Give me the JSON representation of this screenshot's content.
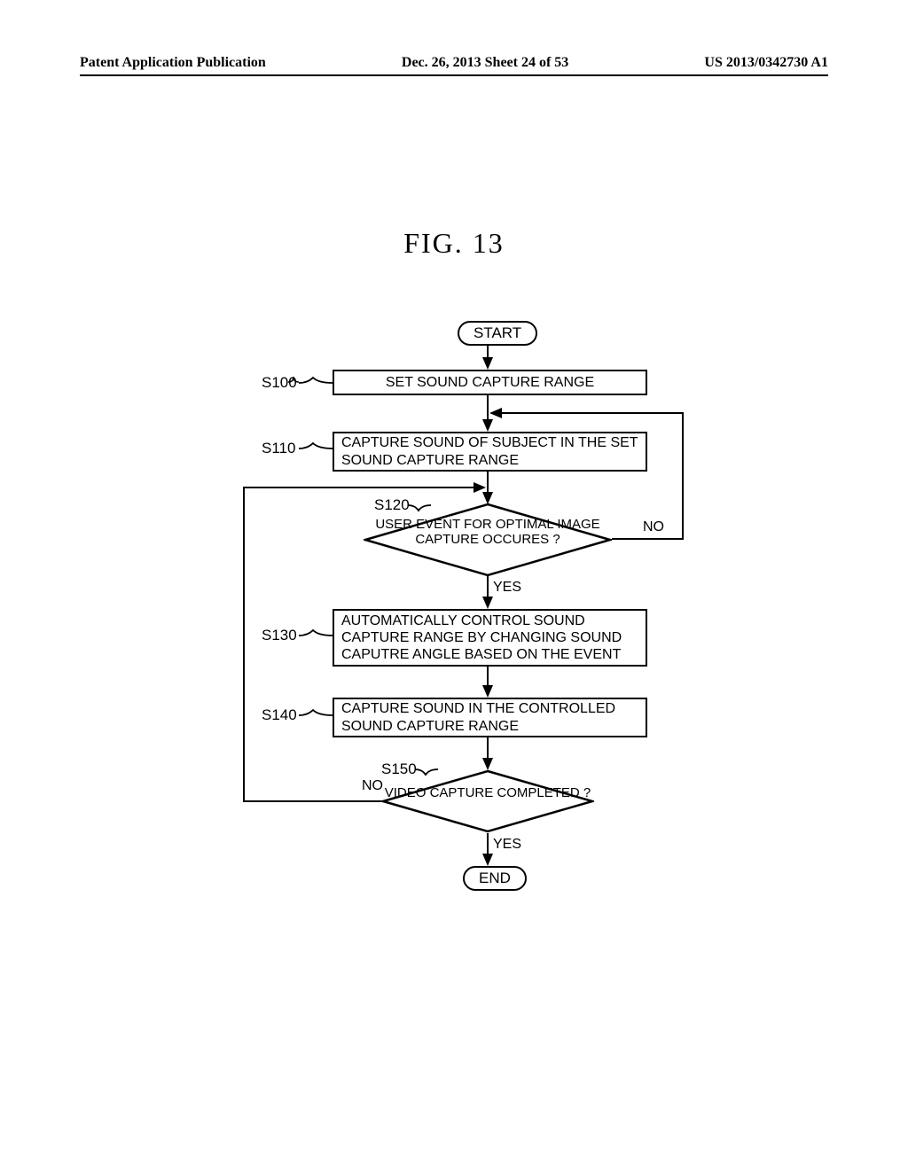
{
  "header": {
    "left": "Patent Application Publication",
    "center": "Dec. 26, 2013  Sheet 24 of 53",
    "right": "US 2013/0342730 A1"
  },
  "figure_title": "FIG.  13",
  "steps": {
    "s100": {
      "label": "S100",
      "text": "SET SOUND CAPTURE RANGE"
    },
    "s110": {
      "label": "S110",
      "text": "CAPTURE SOUND OF SUBJECT IN THE SET SOUND CAPTURE RANGE"
    },
    "s120": {
      "label": "S120",
      "text": "USER EVENT FOR OPTIMAL IMAGE CAPTURE OCCURES ?"
    },
    "s130": {
      "label": "S130",
      "text": "AUTOMATICALLY CONTROL SOUND CAPTURE RANGE BY CHANGING SOUND CAPUTRE ANGLE BASED ON THE EVENT"
    },
    "s140": {
      "label": "S140",
      "text": "CAPTURE SOUND IN THE CONTROLLED SOUND CAPTURE RANGE"
    },
    "s150": {
      "label": "S150",
      "text": "VIDEO CAPTURE COMPLETED ?"
    }
  },
  "terminals": {
    "start": "START",
    "end": "END"
  },
  "branches": {
    "yes": "YES",
    "no": "NO"
  },
  "chart_data": {
    "type": "flowchart",
    "nodes": [
      {
        "id": "start",
        "type": "terminal",
        "label": "START"
      },
      {
        "id": "S100",
        "type": "process",
        "label": "SET SOUND CAPTURE RANGE"
      },
      {
        "id": "S110",
        "type": "process",
        "label": "CAPTURE SOUND OF SUBJECT IN THE SET SOUND CAPTURE RANGE"
      },
      {
        "id": "S120",
        "type": "decision",
        "label": "USER EVENT FOR OPTIMAL IMAGE CAPTURE OCCURES ?"
      },
      {
        "id": "S130",
        "type": "process",
        "label": "AUTOMATICALLY CONTROL SOUND CAPTURE RANGE BY CHANGING SOUND CAPUTRE ANGLE BASED ON THE EVENT"
      },
      {
        "id": "S140",
        "type": "process",
        "label": "CAPTURE SOUND IN THE CONTROLLED SOUND CAPTURE RANGE"
      },
      {
        "id": "S150",
        "type": "decision",
        "label": "VIDEO CAPTURE COMPLETED ?"
      },
      {
        "id": "end",
        "type": "terminal",
        "label": "END"
      }
    ],
    "edges": [
      {
        "from": "start",
        "to": "S100"
      },
      {
        "from": "S100",
        "to": "S110"
      },
      {
        "from": "S110",
        "to": "S120"
      },
      {
        "from": "S120",
        "to": "S130",
        "label": "YES"
      },
      {
        "from": "S120",
        "to": "S110",
        "label": "NO"
      },
      {
        "from": "S130",
        "to": "S140"
      },
      {
        "from": "S140",
        "to": "S150"
      },
      {
        "from": "S150",
        "to": "end",
        "label": "YES"
      },
      {
        "from": "S150",
        "to": "S120",
        "label": "NO",
        "note": "loops back above S120"
      }
    ]
  }
}
